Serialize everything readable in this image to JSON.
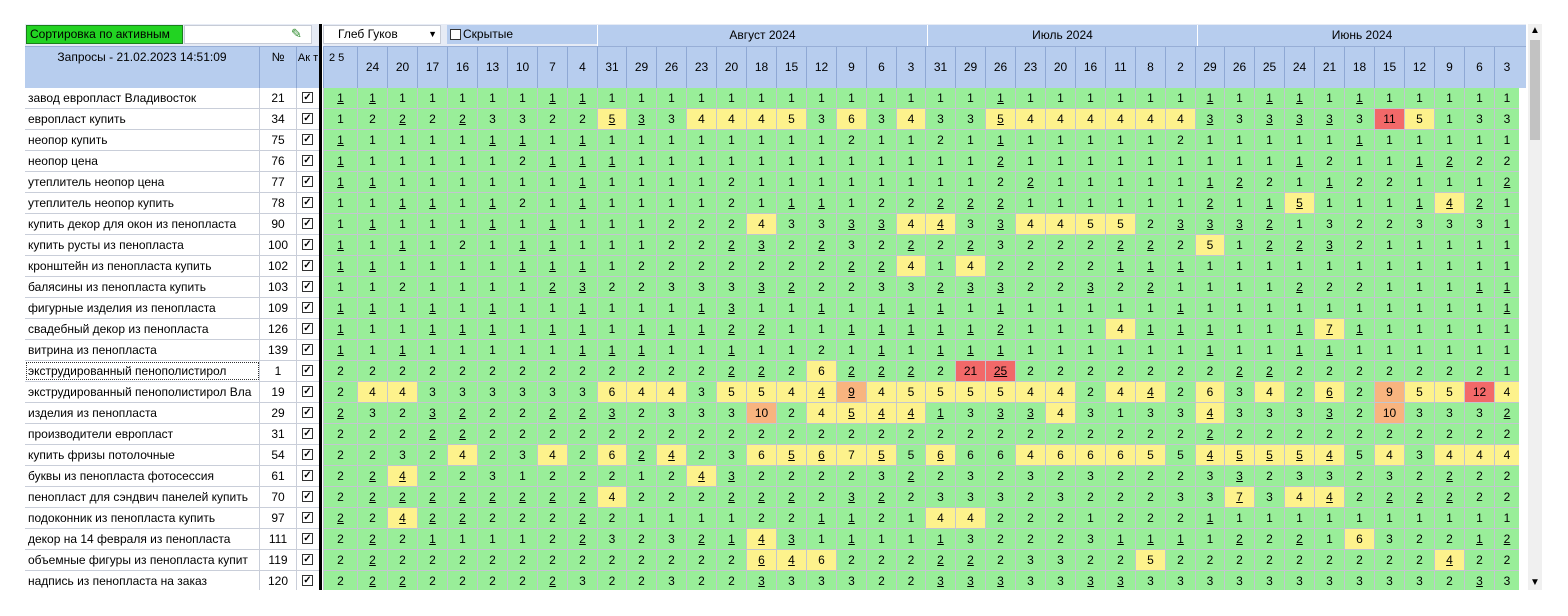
{
  "left_panel": {
    "sort_button": "Сортировка по активным",
    "header_queries": "Запросы - 21.02.2023 14:51:09",
    "header_num": "№",
    "header_active": "Ак т"
  },
  "controls": {
    "person": "Глеб Гуков",
    "hidden_label": "Скрытые"
  },
  "months": [
    "Август 2024",
    "Июль 2024",
    "Июнь 2024"
  ],
  "dates": [
    "2 5",
    "24",
    "20",
    "17",
    "16",
    "13",
    "10",
    "7",
    "4",
    "31",
    "29",
    "26",
    "23",
    "20",
    "18",
    "15",
    "12",
    "9",
    "6",
    "3",
    "31",
    "29",
    "26",
    "23",
    "20",
    "16",
    "11",
    "8",
    "2",
    "29",
    "26",
    "25",
    "24",
    "21",
    "18",
    "15",
    "12",
    "9",
    "6",
    "3"
  ],
  "queries": [
    {
      "q": "завод европласт Владивосток",
      "n": "21"
    },
    {
      "q": "европласт купить",
      "n": "34"
    },
    {
      "q": "неопор купить",
      "n": "75"
    },
    {
      "q": "неопор цена",
      "n": "76"
    },
    {
      "q": "утеплитель неопор цена",
      "n": "77"
    },
    {
      "q": "утеплитель неопор купить",
      "n": "78"
    },
    {
      "q": "купить декор для окон из пенопласта",
      "n": "90"
    },
    {
      "q": "купить русты из пенопласта",
      "n": "100"
    },
    {
      "q": "кронштейн из пенопласта купить",
      "n": "102"
    },
    {
      "q": "балясины из пенопласта купить",
      "n": "103"
    },
    {
      "q": "фигурные изделия из пенопласта",
      "n": "109"
    },
    {
      "q": "свадебный декор из пенопласта",
      "n": "126"
    },
    {
      "q": "витрина из пенопласта",
      "n": "139"
    },
    {
      "q": "экструдированный пенополистирол",
      "n": "1"
    },
    {
      "q": "экструдированный пенополистирол Вла",
      "n": "19"
    },
    {
      "q": "изделия из пенопласта",
      "n": "29"
    },
    {
      "q": "производители европласт",
      "n": "31"
    },
    {
      "q": "купить фризы потолочные",
      "n": "54"
    },
    {
      "q": "буквы из пенопласта фотосессия",
      "n": "61"
    },
    {
      "q": "пенопласт для сэндвич панелей купить",
      "n": "70"
    },
    {
      "q": "подоконник из пенопласта купить",
      "n": "97"
    },
    {
      "q": "декор на 14 февраля из пенопласта",
      "n": "111"
    },
    {
      "q": "объемные фигуры из пенопласта купит",
      "n": "119"
    },
    {
      "q": "надпись из пенопласта на заказ",
      "n": "120"
    }
  ],
  "rows": [
    [
      "1u",
      "1u",
      "1",
      "1",
      "1",
      "1",
      "1",
      "1u",
      "1u",
      "1",
      "1",
      "1",
      "1",
      "1",
      "1",
      "1",
      "1",
      "1",
      "1",
      "1",
      "1",
      "1",
      "1u",
      "1",
      "1",
      "1",
      "1",
      "1",
      "1",
      "1u",
      "1",
      "1u",
      "1u",
      "1",
      "1u",
      "1",
      "1",
      "1",
      "1",
      "1"
    ],
    [
      "1",
      "2",
      "2u",
      "2",
      "2u",
      "3",
      "3",
      "2",
      "2",
      "5yu",
      "3u",
      "3",
      "4y",
      "4y",
      "4y",
      "5y",
      "3",
      "6y",
      "3",
      "4y",
      "3",
      "3",
      "5yu",
      "4y",
      "4y",
      "4y",
      "4y",
      "4y",
      "4y",
      "3u",
      "3",
      "3u",
      "3u",
      "3u",
      "3",
      "11r",
      "5y",
      "1",
      "3",
      "3"
    ],
    [
      "1u",
      "1",
      "1",
      "1",
      "1",
      "1u",
      "1u",
      "1",
      "1u",
      "1",
      "1",
      "1",
      "1",
      "1",
      "1",
      "1",
      "1",
      "2",
      "1",
      "1",
      "2",
      "1",
      "1u",
      "1",
      "1",
      "1",
      "1",
      "1",
      "2",
      "1",
      "1",
      "1",
      "1",
      "1",
      "1u",
      "1",
      "1",
      "1",
      "1",
      "1"
    ],
    [
      "1u",
      "1",
      "1",
      "1",
      "1",
      "1",
      "2",
      "1u",
      "1u",
      "1u",
      "1",
      "1",
      "1",
      "1",
      "1",
      "1",
      "1",
      "1",
      "1",
      "1",
      "1",
      "1",
      "2u",
      "1",
      "1",
      "1",
      "1",
      "1",
      "1",
      "1",
      "1",
      "1",
      "1u",
      "2",
      "1",
      "1",
      "1u",
      "2u",
      "2",
      "2"
    ],
    [
      "1u",
      "1u",
      "1",
      "1",
      "1",
      "1",
      "1",
      "1",
      "1u",
      "1",
      "1",
      "1",
      "1",
      "2",
      "1",
      "1",
      "1",
      "1",
      "1",
      "1",
      "1",
      "1",
      "2",
      "2u",
      "1",
      "1",
      "1",
      "1",
      "1",
      "1u",
      "2u",
      "2",
      "1",
      "1u",
      "2",
      "2",
      "1",
      "1",
      "1",
      "2u"
    ],
    [
      "1",
      "1",
      "1u",
      "1u",
      "1",
      "1u",
      "2",
      "1",
      "1u",
      "1",
      "1",
      "1",
      "1",
      "2",
      "1",
      "1u",
      "1u",
      "1",
      "2",
      "2",
      "2u",
      "2u",
      "2u",
      "1",
      "1",
      "1",
      "1",
      "1",
      "1",
      "2u",
      "1",
      "1u",
      "5yu",
      "1",
      "1",
      "1",
      "1u",
      "4yu",
      "2u",
      "1"
    ],
    [
      "1",
      "1u",
      "1",
      "1",
      "1",
      "1u",
      "1",
      "1u",
      "1",
      "1",
      "1",
      "2",
      "2",
      "2",
      "4y",
      "3",
      "3",
      "3u",
      "3u",
      "4y",
      "4yu",
      "3",
      "3u",
      "4y",
      "4y",
      "5y",
      "5y",
      "2",
      "3u",
      "3u",
      "3u",
      "2u",
      "1",
      "3",
      "2",
      "2",
      "3",
      "3",
      "3",
      "1"
    ],
    [
      "1u",
      "1",
      "1u",
      "1",
      "2",
      "1",
      "1u",
      "1u",
      "1",
      "1",
      "1",
      "2",
      "2",
      "2u",
      "3u",
      "2",
      "2u",
      "3",
      "2",
      "2u",
      "2",
      "2u",
      "3",
      "2",
      "2",
      "2",
      "2u",
      "2u",
      "2",
      "5y",
      "1",
      "2u",
      "2u",
      "3u",
      "2",
      "1",
      "1",
      "1",
      "1",
      "1"
    ],
    [
      "1u",
      "1u",
      "1",
      "1",
      "1",
      "1",
      "1u",
      "1u",
      "1u",
      "1",
      "2",
      "2",
      "2",
      "2",
      "2",
      "2",
      "2",
      "2u",
      "2u",
      "4y",
      "1",
      "4y",
      "2",
      "2",
      "2",
      "2",
      "1u",
      "1u",
      "1u",
      "1",
      "1",
      "1",
      "1",
      "1",
      "1",
      "1",
      "1",
      "1",
      "1",
      "1"
    ],
    [
      "1",
      "1",
      "2",
      "1",
      "1",
      "1",
      "1",
      "2u",
      "3u",
      "2",
      "2",
      "3",
      "3",
      "3",
      "3u",
      "2u",
      "2",
      "2",
      "3",
      "3",
      "2u",
      "3u",
      "3u",
      "2",
      "2",
      "3u",
      "2",
      "2u",
      "1",
      "1",
      "1",
      "1",
      "2u",
      "2",
      "2",
      "1",
      "1",
      "1",
      "1u",
      "1u"
    ],
    [
      "1u",
      "1u",
      "1",
      "1u",
      "1",
      "1u",
      "1",
      "1",
      "1u",
      "1",
      "1",
      "1",
      "1u",
      "3u",
      "1",
      "1",
      "1u",
      "1",
      "1u",
      "1u",
      "1u",
      "1",
      "1u",
      "1",
      "1",
      "1",
      "1",
      "1",
      "1u",
      "1",
      "1",
      "1",
      "1",
      "1",
      "1",
      "1",
      "1",
      "1",
      "1",
      "1u"
    ],
    [
      "1u",
      "1",
      "1",
      "1u",
      "1u",
      "1u",
      "1",
      "1u",
      "1u",
      "1",
      "1u",
      "1u",
      "1u",
      "2u",
      "2u",
      "1",
      "1",
      "1u",
      "1u",
      "1u",
      "1u",
      "1u",
      "2u",
      "1",
      "1",
      "1",
      "4y",
      "1u",
      "1u",
      "1u",
      "1",
      "1",
      "1u",
      "7yu",
      "1u",
      "1",
      "1",
      "1",
      "1",
      "1"
    ],
    [
      "1u",
      "1",
      "1u",
      "1",
      "1",
      "1",
      "1",
      "1",
      "1u",
      "1u",
      "1u",
      "1",
      "1",
      "1u",
      "1",
      "1",
      "2",
      "1",
      "1u",
      "1",
      "1u",
      "1u",
      "1u",
      "1",
      "1",
      "1",
      "1",
      "1",
      "1",
      "1u",
      "1",
      "1",
      "1u",
      "1u",
      "1",
      "1",
      "1",
      "1",
      "1",
      "1"
    ],
    [
      "2",
      "2",
      "2",
      "2",
      "2",
      "2",
      "2",
      "2",
      "2",
      "2",
      "2",
      "2",
      "2",
      "2u",
      "2u",
      "2",
      "6y",
      "2u",
      "2u",
      "2u",
      "2",
      "21r",
      "25ru",
      "2",
      "2",
      "2",
      "2",
      "2",
      "2",
      "2",
      "2u",
      "2u",
      "2",
      "2",
      "2",
      "2",
      "2",
      "2",
      "2",
      "1"
    ],
    [
      "2",
      "4y",
      "4y",
      "3",
      "3",
      "3",
      "3",
      "3",
      "3",
      "6y",
      "4y",
      "4y",
      "3",
      "5y",
      "5y",
      "4y",
      "4yu",
      "9ou",
      "4y",
      "5y",
      "5y",
      "5y",
      "5y",
      "4y",
      "4y",
      "2",
      "4y",
      "4yu",
      "2",
      "6y",
      "3",
      "4y",
      "2",
      "6yu",
      "2",
      "9o",
      "5y",
      "5y",
      "12r",
      "4y"
    ],
    [
      "2u",
      "3",
      "2",
      "3u",
      "2u",
      "2",
      "2",
      "2u",
      "2u",
      "3u",
      "2",
      "3",
      "3",
      "3",
      "10o",
      "2",
      "4y",
      "5yu",
      "4yu",
      "4yu",
      "1u",
      "3",
      "3u",
      "3u",
      "4y",
      "3",
      "1",
      "3",
      "3",
      "4yu",
      "3",
      "3",
      "3",
      "3u",
      "2",
      "10o",
      "3",
      "3",
      "3",
      "2u"
    ],
    [
      "2",
      "2",
      "2",
      "2u",
      "2u",
      "2",
      "2",
      "2",
      "2",
      "2",
      "2",
      "2",
      "2",
      "2",
      "2",
      "2",
      "2",
      "2",
      "2",
      "2",
      "2",
      "2",
      "2",
      "2",
      "2",
      "2",
      "2",
      "2",
      "2",
      "2u",
      "2",
      "2",
      "2",
      "2",
      "2",
      "2",
      "2",
      "2",
      "2",
      "2"
    ],
    [
      "2",
      "2",
      "3",
      "2",
      "4y",
      "2",
      "3",
      "4y",
      "2",
      "6y",
      "2u",
      "4yu",
      "2",
      "3",
      "6y",
      "5yu",
      "6yu",
      "7y",
      "5yu",
      "5",
      "6yu",
      "6",
      "6",
      "4y",
      "6y",
      "6y",
      "6y",
      "5y",
      "5",
      "4yu",
      "5yu",
      "5yu",
      "5yu",
      "4yu",
      "5",
      "4y",
      "3",
      "4y",
      "4y",
      "4y"
    ],
    [
      "2",
      "2u",
      "4yu",
      "2",
      "2",
      "3",
      "1",
      "2",
      "2",
      "2",
      "1",
      "2",
      "4yu",
      "3u",
      "2",
      "2",
      "2",
      "2",
      "3",
      "2u",
      "2",
      "3",
      "2",
      "3",
      "2",
      "3",
      "2",
      "2",
      "2",
      "3",
      "3u",
      "2",
      "3",
      "3",
      "2",
      "3",
      "2",
      "2u",
      "2",
      "2"
    ],
    [
      "2",
      "2u",
      "2u",
      "2u",
      "2u",
      "2u",
      "2u",
      "2u",
      "2u",
      "4y",
      "2",
      "2",
      "2",
      "2u",
      "2u",
      "2u",
      "2",
      "3u",
      "2u",
      "2",
      "3",
      "3",
      "3",
      "2",
      "3",
      "2",
      "2",
      "2",
      "3",
      "3",
      "7yu",
      "3",
      "4y",
      "4yu",
      "2",
      "2u",
      "2u",
      "2u",
      "2",
      "2"
    ],
    [
      "2u",
      "2",
      "4yu",
      "2u",
      "2u",
      "2",
      "2",
      "2",
      "2u",
      "2",
      "1",
      "1",
      "1",
      "1",
      "2",
      "2",
      "1u",
      "1u",
      "2",
      "1",
      "4y",
      "4y",
      "2",
      "2",
      "2",
      "1",
      "2",
      "2",
      "2",
      "1u",
      "1",
      "1",
      "1",
      "1",
      "1",
      "1",
      "1",
      "1",
      "1",
      "1"
    ],
    [
      "2",
      "2u",
      "2",
      "1u",
      "1",
      "1",
      "1",
      "2",
      "2u",
      "3",
      "2",
      "3",
      "2u",
      "1u",
      "4yu",
      "3u",
      "1",
      "1u",
      "1",
      "1",
      "1u",
      "3",
      "2",
      "2",
      "2",
      "3",
      "1u",
      "1u",
      "1u",
      "1",
      "2u",
      "2",
      "2u",
      "1",
      "6y",
      "3",
      "2",
      "2",
      "1u",
      "2u"
    ],
    [
      "2",
      "2u",
      "2",
      "2",
      "2",
      "2",
      "2",
      "2",
      "2",
      "2",
      "2",
      "2",
      "2",
      "2",
      "6yu",
      "4yu",
      "6y",
      "2",
      "2",
      "2",
      "2u",
      "2u",
      "2",
      "3",
      "3",
      "2",
      "2",
      "5y",
      "2",
      "2",
      "2",
      "2",
      "2",
      "2",
      "2",
      "2",
      "2",
      "4yu",
      "2",
      "2"
    ],
    [
      "2",
      "2u",
      "2u",
      "2",
      "2",
      "2",
      "2",
      "2u",
      "3",
      "2",
      "2",
      "3",
      "2",
      "2",
      "3u",
      "3",
      "3",
      "3",
      "2",
      "2",
      "3u",
      "3u",
      "3u",
      "3",
      "3",
      "3u",
      "3u",
      "3",
      "3",
      "3",
      "3",
      "3",
      "3",
      "3",
      "3",
      "3",
      "3",
      "2",
      "3u",
      "3"
    ]
  ]
}
